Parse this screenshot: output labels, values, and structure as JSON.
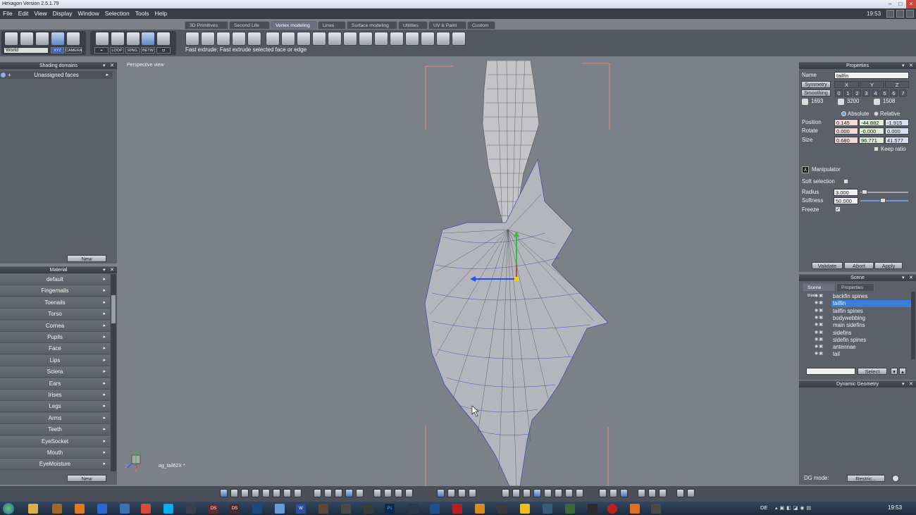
{
  "window": {
    "title": "Hexagon Version 2.5.1.79",
    "clock": "19:53"
  },
  "menu": [
    "File",
    "Edit",
    "View",
    "Display",
    "Window",
    "Selection",
    "Tools",
    "Help"
  ],
  "tabs": [
    "3D Primitives",
    "Second Life",
    "Vertex modeling",
    "Lines",
    "Surface modeling",
    "Utilities",
    "UV & Paint",
    "Custom"
  ],
  "active_tab": "Vertex modeling",
  "toolbar": {
    "coord_dropdown": "World",
    "mode_buttons": [
      "XYZ",
      "CAMERA"
    ],
    "selection_buttons": [
      "LOOP",
      "RING",
      "BETW"
    ],
    "hint": "Fast extrude: Fast extrude selected face or edge"
  },
  "shading_panel": {
    "title": "Shading domains",
    "item": "Unassigned faces",
    "new_button": "New"
  },
  "material_panel": {
    "title": "Material",
    "items": [
      "default",
      "Fingernails",
      "Toenails",
      "Torso",
      "Cornea",
      "Pupils",
      "Face",
      "Lips",
      "Sclera",
      "Ears",
      "Irises",
      "Legs",
      "Arms",
      "Teeth",
      "EyeSocket",
      "Mouth",
      "EyeMoisture"
    ],
    "new_button": "New"
  },
  "viewport": {
    "label": "Perspective view",
    "object_label": "ag_tail62X *"
  },
  "properties": {
    "title": "Properties",
    "name_label": "Name",
    "name_value": "tailfin",
    "symmetry_label": "Symmetry",
    "axes": [
      "X",
      "Y",
      "Z"
    ],
    "smoothing_label": "Smoothing",
    "smoothing_levels": [
      "0",
      "1",
      "2",
      "3",
      "4",
      "5",
      "6",
      "7"
    ],
    "counts": [
      "1693",
      "3200",
      "1508"
    ],
    "absolute": "Absolute",
    "relative": "Relative",
    "position_label": "Position",
    "position": [
      "0.145",
      "-44.882",
      "-1.915"
    ],
    "rotate_label": "Rotate",
    "rotate": [
      "0.000",
      "-0.000",
      "0.000"
    ],
    "size_label": "Size",
    "size": [
      "0.680",
      "96.771",
      "41.577"
    ],
    "keep_ratio": "Keep ratio",
    "manipulator": "Manipulator",
    "soft_selection": "Soft selection",
    "radius_label": "Radius",
    "radius": "3.000",
    "softness_label": "Softness",
    "softness": "50.000",
    "freeze": "Freeze",
    "validate": "Validate",
    "abort": "Abort",
    "apply": "Apply"
  },
  "scene": {
    "title": "Scene",
    "tabs": [
      "Scene tree",
      "Properties"
    ],
    "items": [
      "backfin spines",
      "tailfin",
      "tailfin spines",
      "bodywebbing",
      "main sidefins",
      "sidefins",
      "sidefin spines",
      "antennae",
      "tail"
    ],
    "selected": "tailfin",
    "select_button": "Select"
  },
  "dynamic_geometry": {
    "title": "Dynamic Geometry",
    "dg_mode_label": "DG mode:",
    "dg_mode_value": "Restric..."
  },
  "taskbar": {
    "lang": "DE",
    "clock": "19:53",
    "apps": [
      "DS",
      "DS",
      "W",
      "Ps"
    ]
  }
}
